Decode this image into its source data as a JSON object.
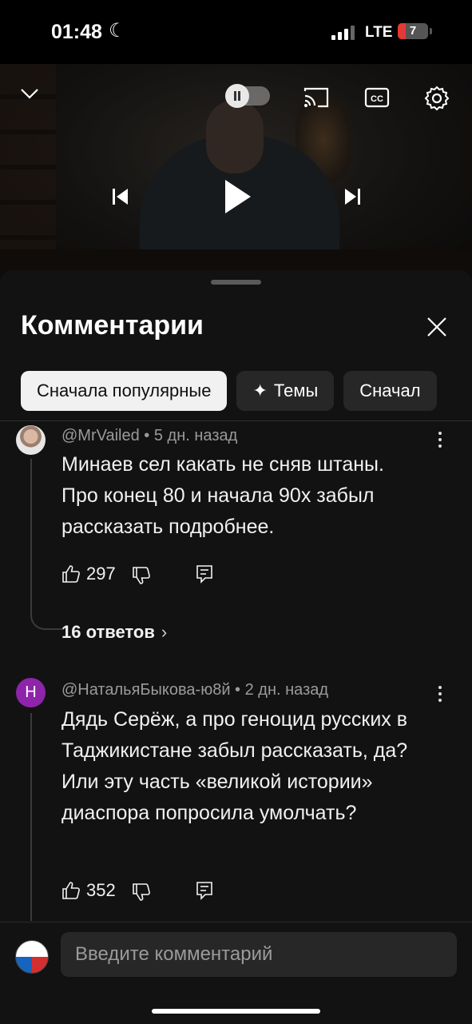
{
  "status_bar": {
    "time": "01:48",
    "network": "LTE",
    "battery": "7"
  },
  "player": {
    "icons": [
      "chevron-down-icon",
      "autoplay-toggle",
      "cast-icon",
      "captions-icon",
      "settings-gear-icon",
      "skip-previous-icon",
      "play-icon",
      "skip-next-icon"
    ]
  },
  "comments_panel": {
    "title": "Комментарии",
    "chips": [
      {
        "label": "Сначала популярные",
        "active": true
      },
      {
        "label": "Темы",
        "icon": "sparkle-icon"
      },
      {
        "label": "Сначал"
      }
    ],
    "comments": [
      {
        "author": "@MrVailed",
        "time": "5 дн. назад",
        "text": "Минаев сел какать не сняв штаны.\nПро конец 80 и начала 90х забыл рассказать подробнее.",
        "likes": "297",
        "replies": "16 ответов"
      },
      {
        "avatar_letter": "Н",
        "author": "@НатальяБыкова-ю8й",
        "time": "2 дн. назад",
        "text": "Дядь Серёж, а про геноцид русских в Таджикистане забыл рассказать, да?\nИли эту часть «великой истории» диаспора попросила умолчать?",
        "likes": "352"
      }
    ],
    "separator": "•",
    "input_placeholder": "Введите комментарий"
  }
}
